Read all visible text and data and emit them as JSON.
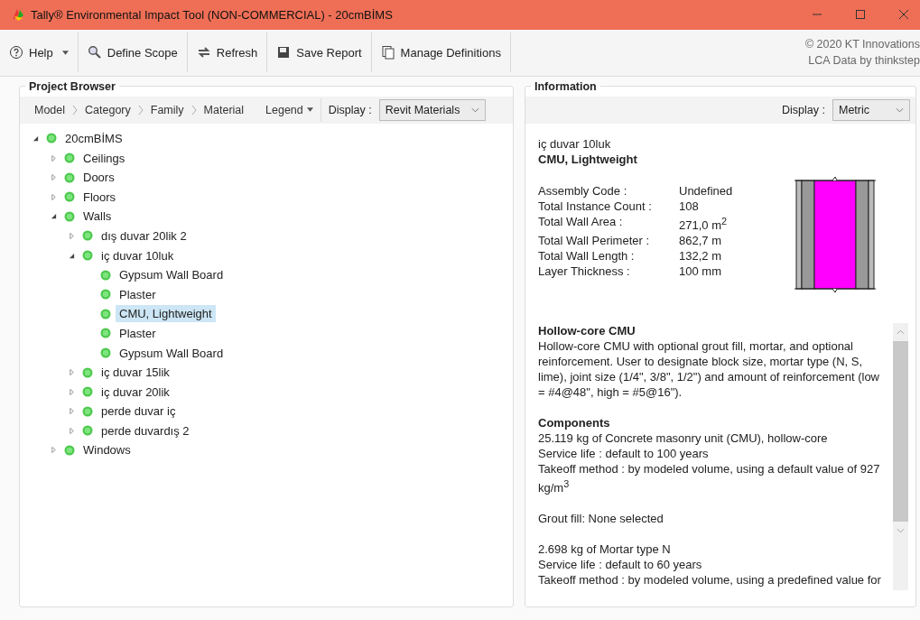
{
  "window": {
    "title": "Tally® Environmental Impact Tool (NON-COMMERCIAL) - 20cmBİMS"
  },
  "toolbar": {
    "buttons": [
      {
        "kind": "help",
        "label": "Help"
      },
      {
        "kind": "scope",
        "label": "Define Scope"
      },
      {
        "kind": "refresh",
        "label": "Refresh"
      },
      {
        "kind": "report",
        "label": "Save Report"
      },
      {
        "kind": "definitions",
        "label": "Manage Definitions"
      }
    ],
    "credits": [
      "© 2020 KT Innovations",
      "LCA Data by thinkstep"
    ]
  },
  "project_browser": {
    "title": "Project Browser",
    "breadcrumb": [
      "Model",
      "Category",
      "Family",
      "Material"
    ],
    "legend": "Legend",
    "display_label": "Display :",
    "display_value": "Revit Materials",
    "tree": [
      {
        "label": "20cmBİMS",
        "expanded": true,
        "selected": false,
        "children": [
          {
            "label": "Ceilings",
            "expanded": false,
            "selected": false
          },
          {
            "label": "Doors",
            "expanded": false,
            "selected": false
          },
          {
            "label": "Floors",
            "expanded": false,
            "selected": false
          },
          {
            "label": "Walls",
            "expanded": true,
            "selected": false,
            "children": [
              {
                "label": "dış duvar 20lik 2",
                "expanded": false,
                "selected": false
              },
              {
                "label": "iç duvar 10luk",
                "expanded": true,
                "selected": false,
                "children": [
                  {
                    "label": "Gypsum Wall Board",
                    "selected": false
                  },
                  {
                    "label": "Plaster",
                    "selected": false
                  },
                  {
                    "label": "CMU, Lightweight",
                    "selected": true
                  },
                  {
                    "label": "Plaster",
                    "selected": false
                  },
                  {
                    "label": "Gypsum Wall Board",
                    "selected": false
                  }
                ]
              },
              {
                "label": "iç duvar 15lik",
                "expanded": false,
                "selected": false
              },
              {
                "label": "iç duvar 20lik",
                "expanded": false,
                "selected": false
              },
              {
                "label": "perde duvar iç",
                "expanded": false,
                "selected": false
              },
              {
                "label": "perde duvardış 2",
                "expanded": false,
                "selected": false
              }
            ]
          },
          {
            "label": "Windows",
            "expanded": false,
            "selected": false
          }
        ]
      }
    ]
  },
  "information": {
    "title": "Information",
    "display_label": "Display :",
    "display_value": "Metric",
    "assembly": "iç duvar 10luk",
    "material": "CMU, Lightweight",
    "properties": [
      {
        "label": "Assembly Code :",
        "value": "Undefined"
      },
      {
        "label": "Total Instance Count :",
        "value": "108"
      },
      {
        "label": "Total Wall Area :",
        "value": "271,0 m$^{2}$"
      },
      {
        "label": "Total Wall Perimeter :",
        "value": "862,7 m"
      },
      {
        "label": "Total Wall Length :",
        "value": "132,2 m"
      },
      {
        "label": "Layer Thickness :",
        "value": "100 mm"
      }
    ],
    "sections": [
      {
        "heading": "Hollow-core CMU",
        "lines": [
          "Hollow-core CMU with optional grout fill, mortar, and optional reinforcement. User to designate block size, mortar type (N, S, lime), joint size (1/4\", 3/8\", 1/2\") and amount of reinforcement (low = #4@48\", high = #5@16\")."
        ]
      },
      {
        "heading": "Components",
        "lines": [
          "25.119 kg of Concrete masonry unit (CMU), hollow-core",
          "Service life : default to 100 years",
          "Takeoff method : by modeled volume, using a default value of 927 kg/m$^{3}$"
        ]
      },
      {
        "lines": [
          "Grout fill: None selected"
        ]
      },
      {
        "lines": [
          "2.698 kg of Mortar type N",
          "Service life : default to 60 years",
          "Takeoff method : by modeled volume, using a predefined value for"
        ]
      }
    ]
  }
}
